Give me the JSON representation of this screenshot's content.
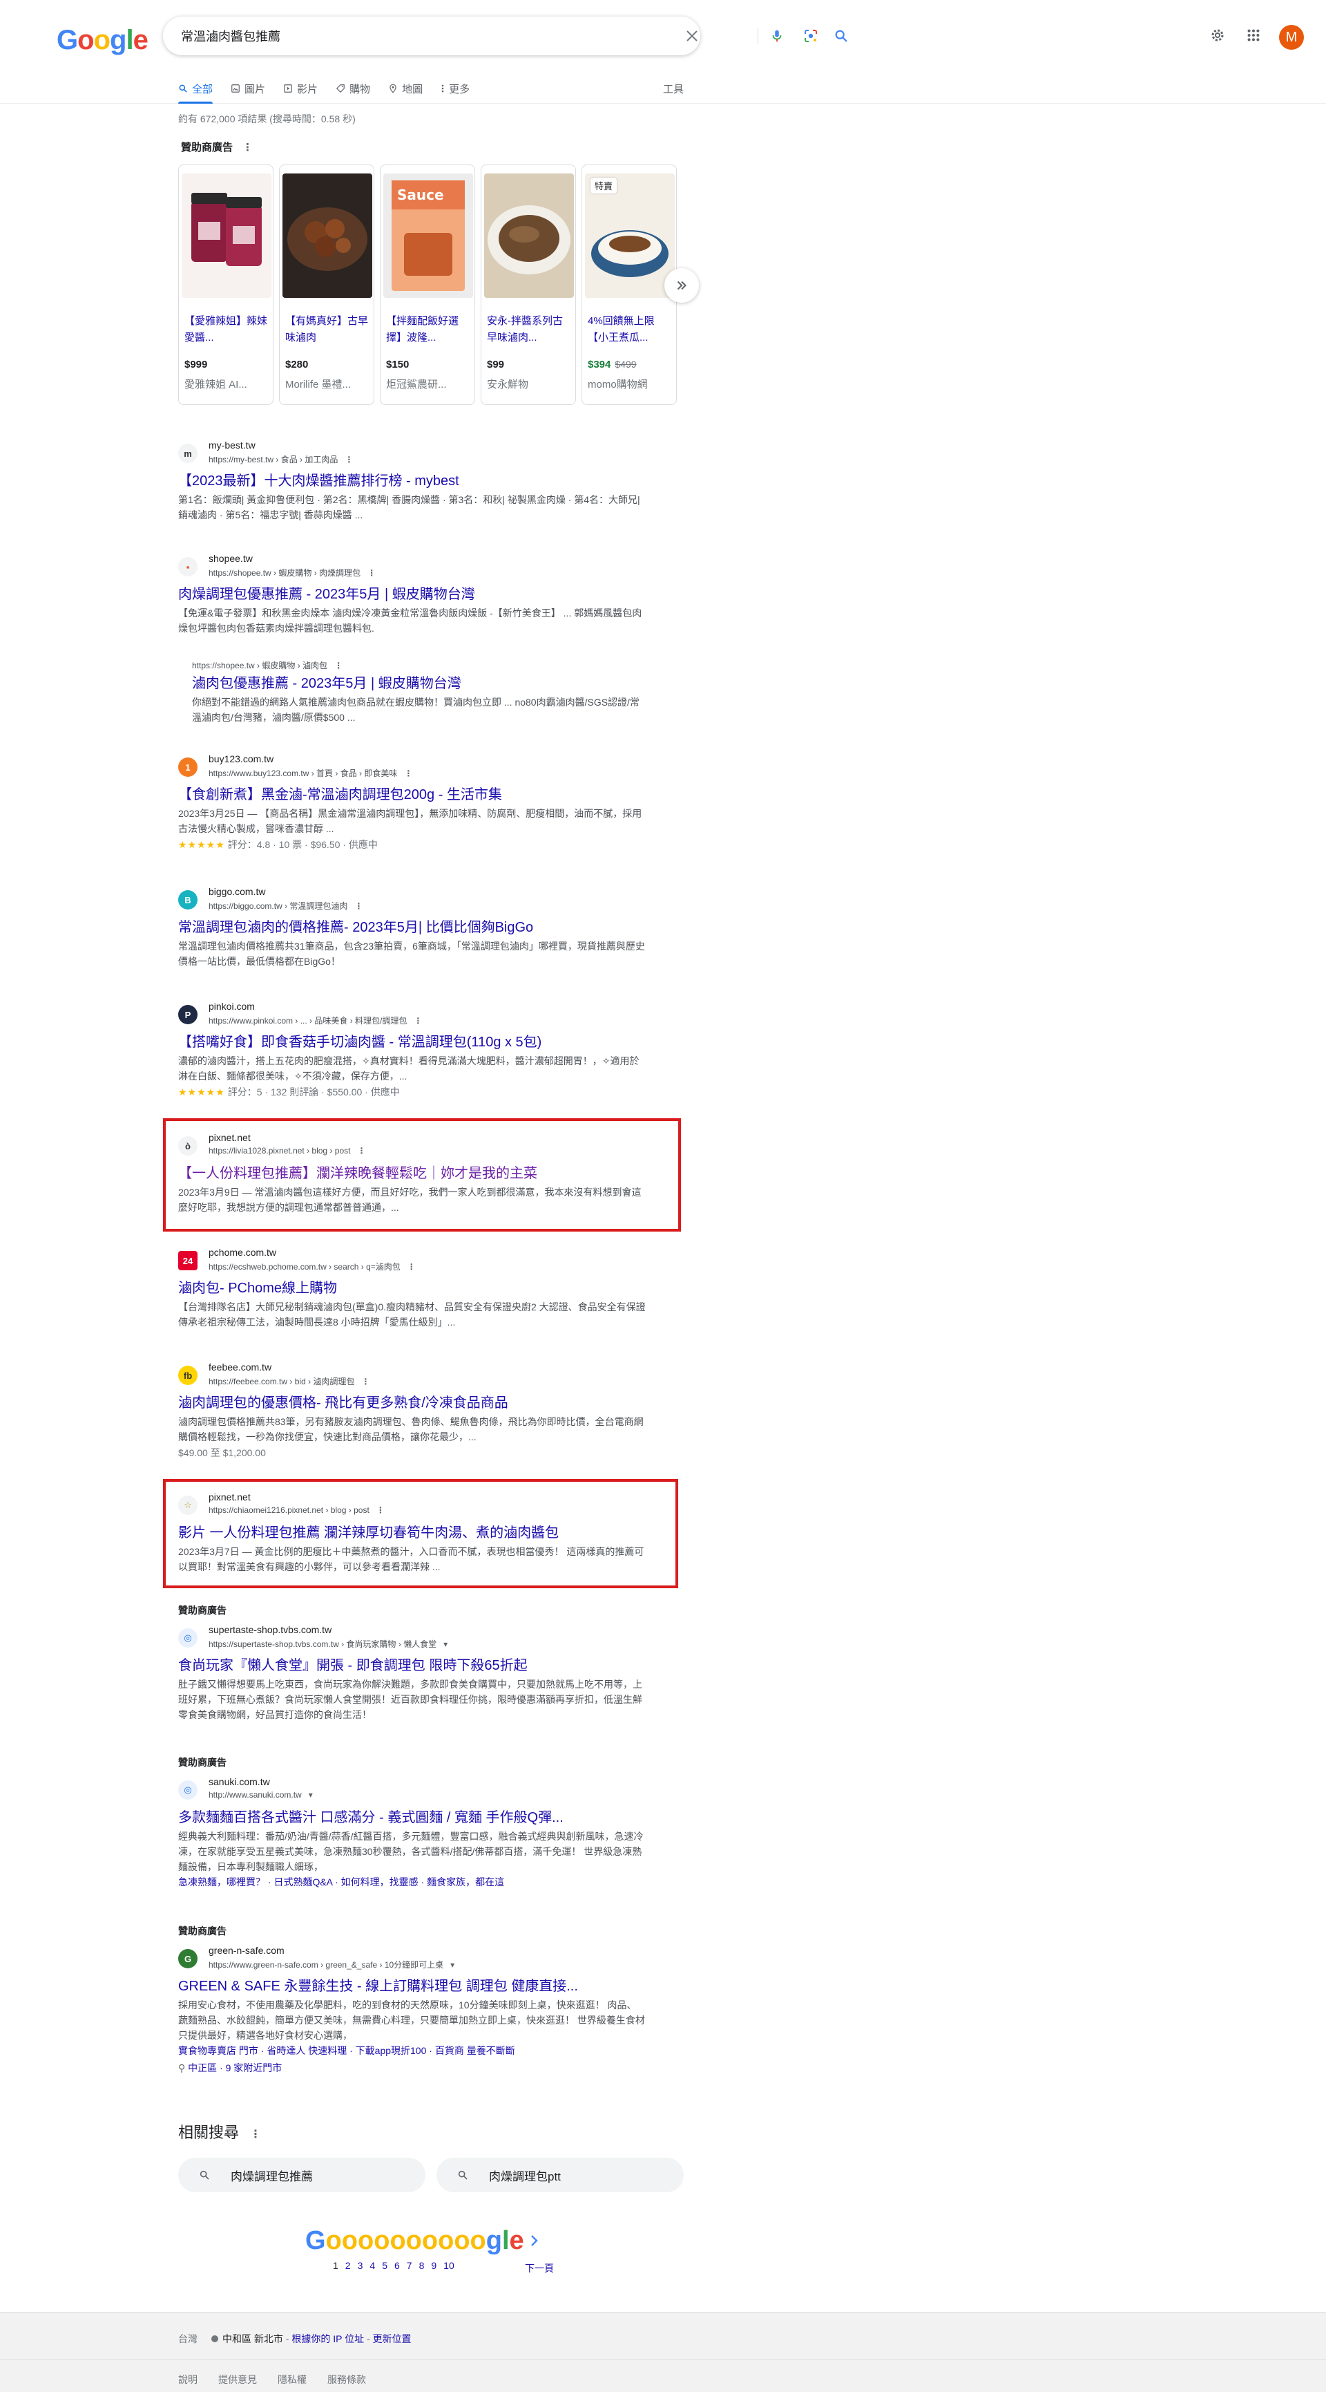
{
  "header": {
    "logo": [
      "G",
      "o",
      "o",
      "g",
      "l",
      "e"
    ],
    "search_query": "常溫滷肉醬包推薦",
    "avatar_letter": "M"
  },
  "tabs": [
    {
      "label": "全部",
      "icon": "search-icon"
    },
    {
      "label": "圖片",
      "icon": "image-icon"
    },
    {
      "label": "影片",
      "icon": "video-icon"
    },
    {
      "label": "購物",
      "icon": "tag-icon"
    },
    {
      "label": "地圖",
      "icon": "pin-icon"
    },
    {
      "label": "更多",
      "icon": "more-vert-icon"
    }
  ],
  "tools_label": "工具",
  "stats": "約有 672,000 項結果 (搜尋時間：0.58 秒)",
  "shopping": {
    "ad_label": "贊助商廣告",
    "products": [
      {
        "title": "【愛雅辣姐】辣妹愛醬...",
        "price": "$999",
        "merchant": "愛雅辣姐 AI..."
      },
      {
        "title": "【有媽真好】古早味滷肉",
        "price": "$280",
        "merchant": "Morilife 墨禮..."
      },
      {
        "title": "【拌麵配飯好選擇】波隆...",
        "price": "$150",
        "merchant": "炬冠鯊農研..."
      },
      {
        "title": "安永-拌醬系列古早味滷肉...",
        "price": "$99",
        "merchant": "安永鮮物"
      },
      {
        "title": "4%回饋無上限【小王煮瓜...",
        "price": "$394",
        "old_price": "$499",
        "merchant": "momo購物網",
        "badge": "特賣"
      }
    ]
  },
  "results": [
    {
      "site": "my-best.tw",
      "cite": "https://my-best.tw › 食品 › 加工肉品",
      "title": "【2023最新】十大肉燥醬推薦排行榜 - mybest",
      "snippet": "第1名：飯爛頭| 黃金抑鲁便利包 · 第2名：黑橋牌| 香腸肉燥醬 · 第3名：和秋| 祕製黑金肉燥 · 第4名：大師兄| 銷魂滷肉 · 第5名：福忠字號| 香蒜肉燥醬 ..."
    },
    {
      "site": "shopee.tw",
      "cite": "https://shopee.tw › 蝦皮購物 › 肉燥調理包",
      "title": "肉燥調理包優惠推薦 - 2023年5月 | 蝦皮購物台灣",
      "snippet": "【免運&電子發票】和秋黑金肉燥本 滷肉燥冷凍黃金粒常溫魯肉飯肉燥飯 -【新竹美食王】 ... 郭媽媽風醬包肉燥包坪醬包肉包香菇素肉燥拌醬調理包醬料包."
    },
    {
      "site": "",
      "cite": "https://shopee.tw › 蝦皮購物 › 滷肉包",
      "title": "滷肉包優惠推薦 - 2023年5月 | 蝦皮購物台灣",
      "snippet": "你絕對不能錯過的網路人氣推薦滷肉包商品就在蝦皮購物！買滷肉包立即 ... no80肉霸滷肉醬/SGS認證/常溫滷肉包/台灣豬，滷肉醬/原價$500 ..."
    },
    {
      "site": "buy123.com.tw",
      "cite": "https://www.buy123.com.tw › 首頁 › 食品 › 即食美味",
      "title": "【食創新煮】黑金滷-常溫滷肉調理包200g - 生活市集",
      "snippet": "2023年3月25日 — 【商品名稱】黑金滷常溫滷肉調理包】，無添加味精、防腐劑、肥瘦相間，油而不膩，採用古法慢火精心製成，嘗咪香濃甘醇 ...",
      "rating": "評分：4.8 · 10 票 · $96.50 · 供應中"
    },
    {
      "site": "biggo.com.tw",
      "cite": "https://biggo.com.tw › 常溫調理包滷肉",
      "title": "常溫調理包滷肉的價格推薦- 2023年5月| 比價比個夠BigGo",
      "snippet": "常溫調理包滷肉價格推薦共31筆商品，包含23筆拍賣，6筆商城，「常溫調理包滷肉」哪裡買，現貨推薦與歷史價格一站比價，最低價格都在BigGo！"
    },
    {
      "site": "pinkoi.com",
      "cite": "https://www.pinkoi.com › ... › 品味美食 › 料理包/調理包",
      "title": "【搭嘴好食】即食香菇手切滷肉醬 - 常溫調理包(110g x 5包)",
      "snippet": "濃郁的滷肉醬汁，搭上五花肉的肥瘦混搭，✧真材實料！看得見滿滿大塊肥料，醬汁濃郁超開胃！，✧適用於淋在白飯、麵條都很美味，✧不須冷藏，保存方便，...",
      "rating": "評分：5 · 132 則評論 · $550.00 · 供應中"
    },
    {
      "site": "pixnet.net",
      "cite": "https://livia1028.pixnet.net › blog › post",
      "title": "【一人份料理包推薦】瀾洋辣晚餐輕鬆吃｜妳才是我的主菜",
      "snippet": "2023年3月9日 — 常溫滷肉醬包這樣好方便，而且好好吃，我們一家人吃到都很滿意，我本來沒有料想到會這麼好吃耶，我想說方便的調理包通常都普普通通，..."
    },
    {
      "site": "pchome.com.tw",
      "cite": "https://ecshweb.pchome.com.tw › search › q=滷肉包",
      "title": "滷肉包- PChome線上購物",
      "snippet": "【台灣排隊名店】大師兄秘制銷魂滷肉包(單盒)0.瘦肉精豬材、品質安全有保證央廚2 大認證、食品安全有保證傳承老祖宗秘傳工法，滷製時間長達8 小時招牌「愛馬仕級別」..."
    },
    {
      "site": "feebee.com.tw",
      "cite": "https://feebee.com.tw › bid › 滷肉調理包",
      "title": "滷肉調理包的優惠價格- 飛比有更多熟食/冷凍食品商品",
      "snippet": "滷肉調理包價格推薦共83筆，另有豬胺友滷肉調理包、魯肉條、鯷魚魯肉條，飛比為你即時比價，全台電商網購價格輕鬆找，一秒為你找便宜，快速比對商品價格，讓你花最少，...",
      "extra": "$49.00 至 $1,200.00"
    },
    {
      "site": "pixnet.net",
      "cite": "https://chiaomei1216.pixnet.net › blog › post",
      "title": "影片 一人份料理包推薦 瀾洋辣厚切春筍牛肉湯、煮的滷肉醬包",
      "snippet": "2023年3月7日 — 黃金比例的肥瘦比＋中藥熬煮的醬汁，入口香而不膩，表現也相當優秀！ 這兩樣真的推薦可以買耶！對常溫美食有興趣的小夥伴，可以參考看看瀾洋辣 ..."
    }
  ],
  "ads": [
    {
      "ad_label": "贊助商廣告",
      "site": "supertaste-shop.tvbs.com.tw",
      "cite": "https://supertaste-shop.tvbs.com.tw › 食尚玩家購物 › 懶人食堂",
      "title": "食尚玩家『懶人食堂』開張 - 即食調理包 限時下殺65折起",
      "snippet": "肚子餓又懶得想要馬上吃東西，食尚玩家為你解決難題，多款即食美食購買中，只要加熱就馬上吃不用等，上班好累，下班無心煮飯？食尚玩家懶人食堂開張！近百款即食料理任你挑，限時優惠滿額再享折扣，低溫生鮮零食美食購物網，好品質打造你的食尚生活！"
    },
    {
      "ad_label": "贊助商廣告",
      "site": "sanuki.com.tw",
      "cite": "http://www.sanuki.com.tw",
      "title": "多款麵麵百搭各式醬汁 口感滿分 - 義式圓麵 / 寬麵 手作般Q彈...",
      "snippet": "經典義大利麵料理：番茄/奶油/青醬/蒜香/紅醬百搭，多元麵體，豐富口感，融合義式經典與創新風味，急速冷凍，在家就能享受五星義式美味，急凍熟麵30秒覆熱，各式醬料/搭配/佛蒂都百搭，滿千免運！ 世界級急凍熟麵設備，日本專利製麵職人細琢，",
      "sitelinks": "急凍熟麵，哪裡買？ · 日式熟麵Q&A · 如何料理，找靈感 · 麵食家族，都在這"
    },
    {
      "ad_label": "贊助商廣告",
      "site": "green-n-safe.com",
      "cite": "https://www.green-n-safe.com › green_&_safe › 10分鐘即可上桌",
      "title": "GREEN & SAFE 永豐餘生技 - 線上訂購料理包 調理包 健康直接...",
      "snippet": "採用安心食材，不使用農藥及化學肥料，吃的到食材的天然原味，10分鐘美味即刻上桌，快來逛逛！ 肉品、 蔬麵熟品、水餃餛飩，簡單方便又美味，無需費心料理，只要簡單加熱立即上桌，快來逛逛！ 世界級養生食材只提供最好，精選各地好食材安心選購，",
      "sitelinks": "實食物專賣店 門市 · 省時達人 快速料理 · 下載app現折100 · 百貨商 量養不斷斷",
      "location": "中正區 · 9 家附近門市"
    }
  ],
  "related": {
    "title": "相關搜尋",
    "items": [
      "肉燥調理包推薦",
      "肉燥調理包ptt"
    ]
  },
  "pagination": {
    "pages": [
      "1",
      "2",
      "3",
      "4",
      "5",
      "6",
      "7",
      "8",
      "9",
      "10"
    ],
    "next_label": "下一頁"
  },
  "footer": {
    "country": "台灣",
    "location": "中和區 新北市",
    "ip_link": "根據你的 IP 位址",
    "update_link": "更新位置",
    "links": [
      "說明",
      "提供意見",
      "隱私權",
      "服務條款"
    ]
  },
  "colors": {
    "link": "#1a0dab",
    "visited": "#681da8",
    "accent": "#1a73e8",
    "highlight_box": "#d91c1c"
  }
}
